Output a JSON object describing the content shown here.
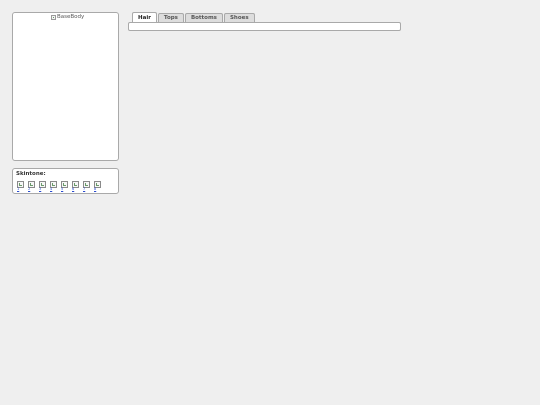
{
  "preview": {
    "base_body_alt": "BaseBody"
  },
  "skintone": {
    "label": "Skintone:",
    "options": [
      {
        "text": "1"
      },
      {
        "text": "2"
      },
      {
        "text": "3"
      },
      {
        "text": "4"
      },
      {
        "text": "5"
      },
      {
        "text": "6"
      },
      {
        "text": "7"
      },
      {
        "text": "8"
      }
    ]
  },
  "tabs": [
    {
      "label": "Hair",
      "active": true
    },
    {
      "label": "Tops",
      "active": false
    },
    {
      "label": "Bottoms",
      "active": false
    },
    {
      "label": "Shoes",
      "active": false
    }
  ]
}
